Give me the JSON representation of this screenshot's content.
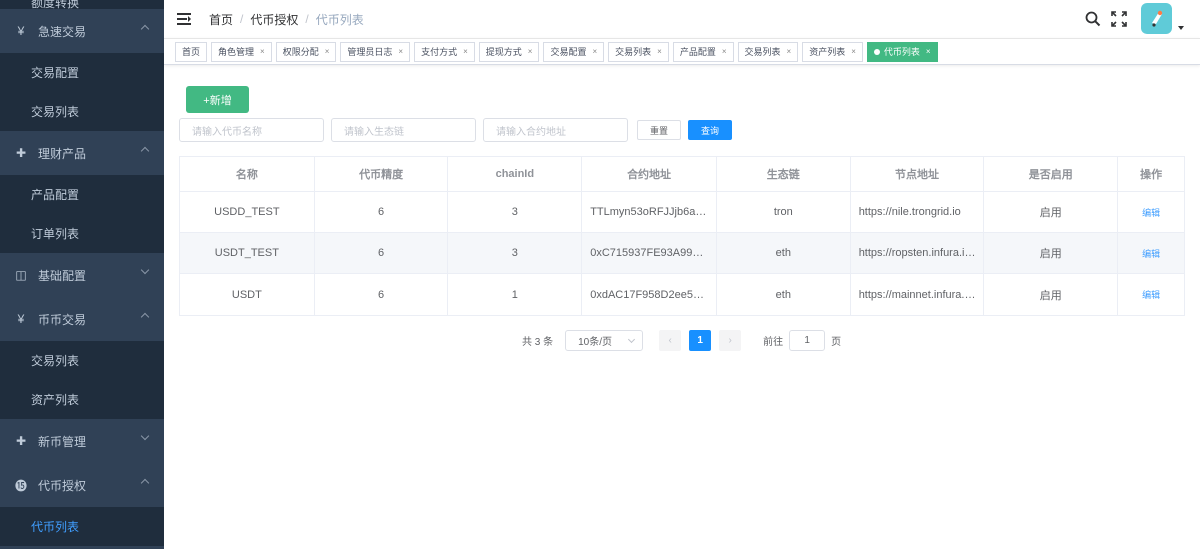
{
  "sidebar": {
    "partial_top": "额度转换",
    "items": [
      {
        "label": "急速交易",
        "icon": "yen-icon",
        "glyph": "¥",
        "expanded": true
      },
      {
        "label": "交易配置"
      },
      {
        "label": "交易列表"
      },
      {
        "label": "理财产品",
        "icon": "plus-circle-icon",
        "glyph": "✚",
        "expanded": true
      },
      {
        "label": "产品配置"
      },
      {
        "label": "订单列表"
      },
      {
        "label": "基础配置",
        "icon": "book-icon",
        "glyph": "◫",
        "expanded": false
      },
      {
        "label": "币币交易",
        "icon": "yen-icon",
        "glyph": "¥",
        "expanded": true
      },
      {
        "label": "交易列表"
      },
      {
        "label": "资产列表"
      },
      {
        "label": "新币管理",
        "icon": "plus-circle-icon",
        "glyph": "✚",
        "expanded": false
      },
      {
        "label": "代币授权",
        "icon": "token-icon",
        "glyph": "⓯",
        "expanded": true
      },
      {
        "label": "代币列表"
      }
    ],
    "colors": {
      "bg": "#304156",
      "sub_bg": "#1f2d3d",
      "active": "#409eff"
    }
  },
  "breadcrumb": [
    "首页",
    "代币授权",
    "代币列表"
  ],
  "tags": [
    {
      "label": "首页",
      "closable": false
    },
    {
      "label": "角色管理",
      "closable": true
    },
    {
      "label": "权限分配",
      "closable": true
    },
    {
      "label": "管理员日志",
      "closable": true
    },
    {
      "label": "支付方式",
      "closable": true
    },
    {
      "label": "提现方式",
      "closable": true
    },
    {
      "label": "交易配置",
      "closable": true
    },
    {
      "label": "交易列表",
      "closable": true
    },
    {
      "label": "产品配置",
      "closable": true
    },
    {
      "label": "交易列表",
      "closable": true
    },
    {
      "label": "资产列表",
      "closable": true
    },
    {
      "label": "代币列表",
      "closable": true,
      "active": true
    }
  ],
  "toolbar": {
    "add_label": "+新增",
    "reset_label": "重置",
    "query_label": "查询"
  },
  "filters": {
    "name_placeholder": "请输入代币名称",
    "chain_placeholder": "请输入生态链",
    "contract_placeholder": "请输入合约地址"
  },
  "table": {
    "columns": [
      "名称",
      "代币精度",
      "chainId",
      "合约地址",
      "生态链",
      "节点地址",
      "是否启用",
      "操作"
    ],
    "rows": [
      {
        "name": "USDD_TEST",
        "precision": "6",
        "chainId": "3",
        "contract": "TTLmyn53oRFJJjb6a…",
        "chain": "tron",
        "node": "https://nile.trongrid.io",
        "enabled": "启用",
        "action": "编辑"
      },
      {
        "name": "USDT_TEST",
        "precision": "6",
        "chainId": "3",
        "contract": "0xC715937FE93A99…",
        "chain": "eth",
        "node": "https://ropsten.infura.i…",
        "enabled": "启用",
        "action": "编辑"
      },
      {
        "name": "USDT",
        "precision": "6",
        "chainId": "1",
        "contract": "0xdAC17F958D2ee5…",
        "chain": "eth",
        "node": "https://mainnet.infura.…",
        "enabled": "启用",
        "action": "编辑"
      }
    ]
  },
  "pagination": {
    "total_text": "共 3 条",
    "page_size": "10条/页",
    "prev": "‹",
    "current": "1",
    "next": "›",
    "goto_label": "前往",
    "goto_value": "1",
    "page_suffix": "页"
  },
  "colors": {
    "primary": "#1890ff",
    "success": "#42b983"
  }
}
